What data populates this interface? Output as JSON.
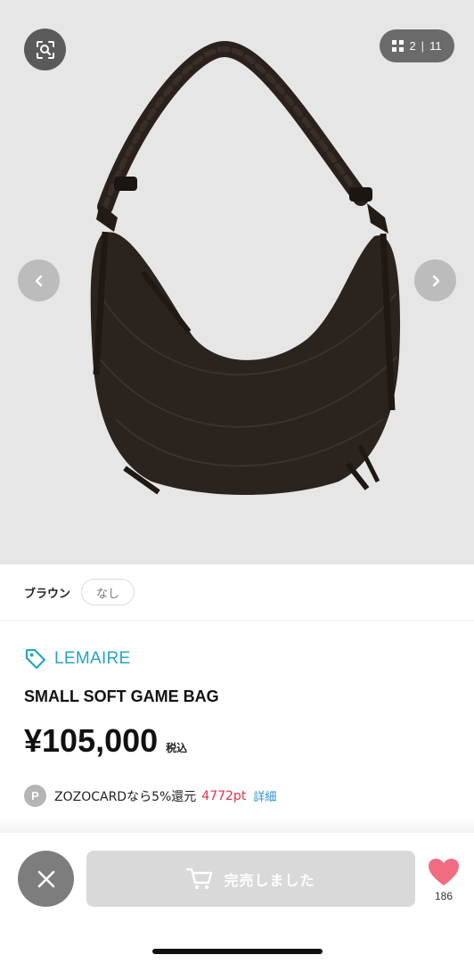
{
  "gallery": {
    "counter_current": "2",
    "counter_separator": "|",
    "counter_total": "11",
    "image_alt_icon": "bag-product-photo",
    "background_color": "#e6e6e6"
  },
  "variant": {
    "color_label": "ブラウン",
    "size_label": "なし"
  },
  "product": {
    "brand": "LEMAIRE",
    "title": "SMALL SOFT GAME BAG",
    "price": "¥105,000",
    "tax_label": "税込"
  },
  "points": {
    "badge": "P",
    "text": "ZOZOCARDなら5%還元",
    "amount": "4772pt",
    "detail_link": "詳細"
  },
  "bottom_bar": {
    "cart_label": "完売しました",
    "favorite_count": "186"
  },
  "colors": {
    "brand_accent": "#27a3c4",
    "point_red": "#e0334a",
    "link_blue": "#2c8fd4",
    "heart_pink": "#f06c80",
    "sold_out_button": "#d9d9d9"
  }
}
